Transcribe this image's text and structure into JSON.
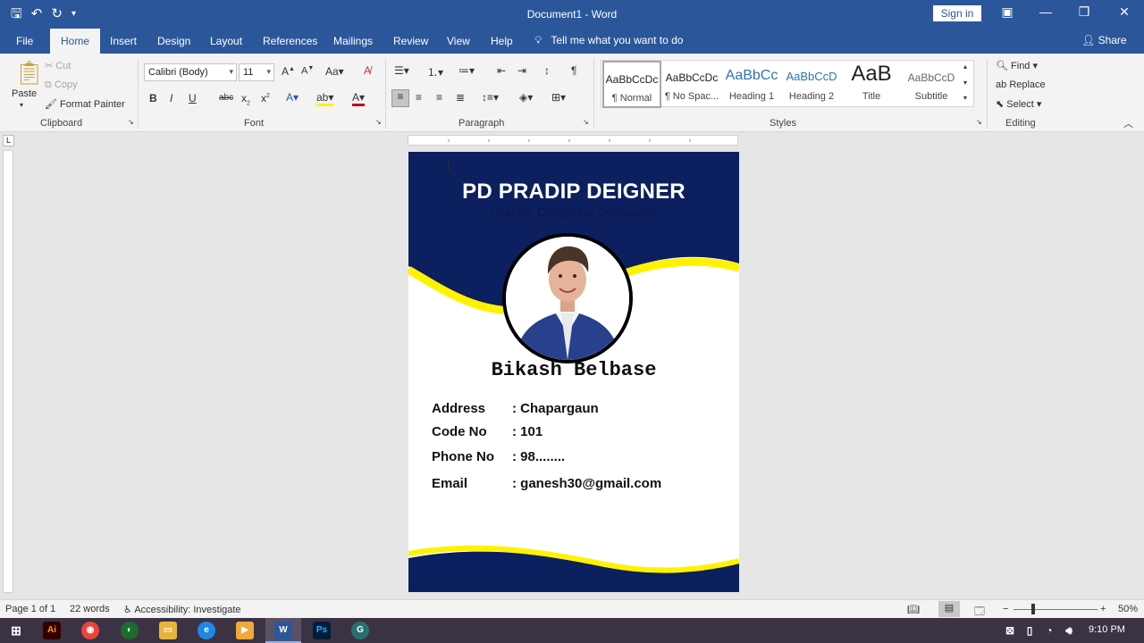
{
  "window": {
    "title": "Document1  -  Word",
    "sign_in": "Sign in"
  },
  "tabs": [
    "File",
    "Home",
    "Insert",
    "Design",
    "Layout",
    "References",
    "Mailings",
    "Review",
    "View",
    "Help"
  ],
  "tell_me": "Tell me what you want to do",
  "share": "Share",
  "clipboard": {
    "paste": "Paste",
    "cut": "Cut",
    "copy": "Copy",
    "format_painter": "Format Painter",
    "label": "Clipboard"
  },
  "font": {
    "family": "Calibri (Body)",
    "size": "11",
    "label": "Font"
  },
  "paragraph": {
    "label": "Paragraph"
  },
  "styles": {
    "label": "Styles",
    "items": [
      {
        "preview": "AaBbCcDc",
        "name": "¶ Normal"
      },
      {
        "preview": "AaBbCcDc",
        "name": "¶ No Spac..."
      },
      {
        "preview": "AaBbCc",
        "name": "Heading 1"
      },
      {
        "preview": "AaBbCcD",
        "name": "Heading 2"
      },
      {
        "preview": "AaB",
        "name": "Title"
      },
      {
        "preview": "AaBbCcD",
        "name": "Subtitle"
      }
    ]
  },
  "editing": {
    "find": "Find",
    "replace": "Replace",
    "select": "Select",
    "label": "Editing"
  },
  "document": {
    "company": "PD PRADIP DEIGNER",
    "tagline": "Graphic Designing Companey",
    "person_name": "Bikash Belbase",
    "fields": [
      {
        "label": "Address",
        "value": ": Chapargaun"
      },
      {
        "label": "Code No",
        "value": ": 101"
      },
      {
        "label": "Phone No",
        "value": ": 98........"
      },
      {
        "label": "Email",
        "value": ": ganesh30@gmail.com"
      }
    ],
    "colors": {
      "navy": "#0c1f5e",
      "yellow": "#fff200"
    }
  },
  "status": {
    "page": "Page 1 of 1",
    "words": "22 words",
    "accessibility": "Accessibility: Investigate",
    "zoom": "50%"
  },
  "taskbar": {
    "time": "9:10 PM"
  }
}
